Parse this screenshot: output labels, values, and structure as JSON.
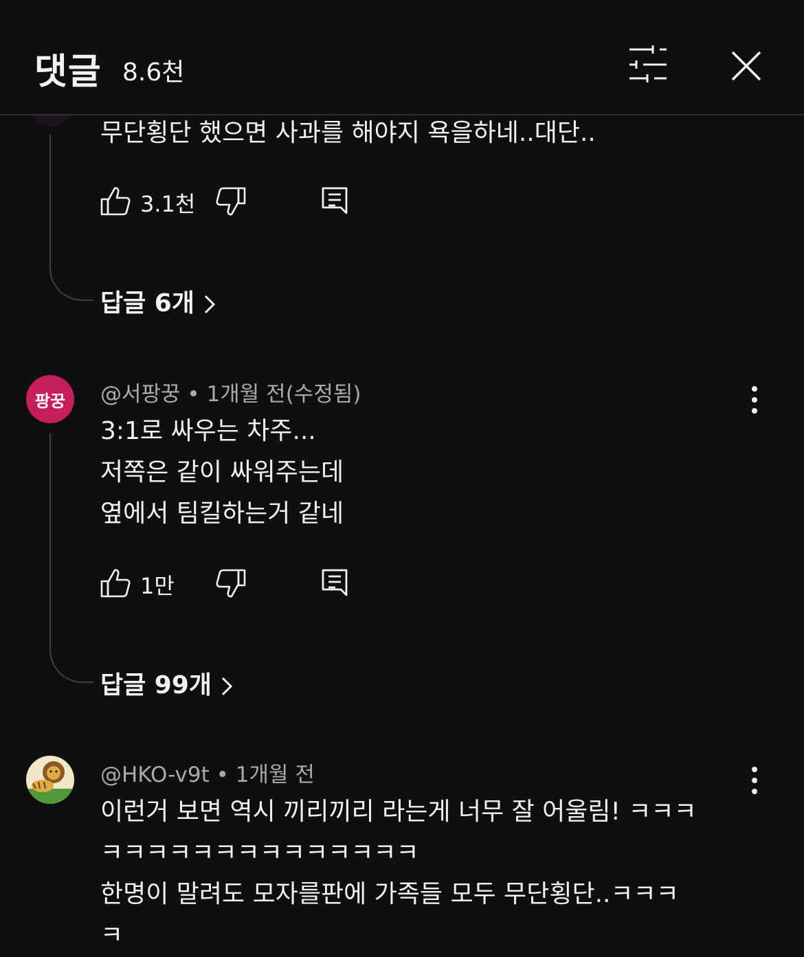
{
  "header": {
    "title": "댓글",
    "count": "8.6천"
  },
  "comments": [
    {
      "text_lines": [
        "무단횡단 했으면 사과를 해야지 욕을하네..대단.."
      ],
      "likes": "3.1천",
      "replies_label": "답글 6개"
    },
    {
      "avatar_text": "팡꿍",
      "avatar_color": "#c41e5c",
      "author": "@서팡꿍",
      "time": "1개월 전(수정됨)",
      "text_lines": [
        "3:1로 싸우는 차주...",
        "저쪽은 같이 싸워주는데",
        "옆에서 팀킬하는거 같네"
      ],
      "likes": "1만",
      "replies_label": "답글 99개"
    },
    {
      "avatar_icon": "lion-avatar",
      "author": "@HKO-v9t",
      "time": "1개월 전",
      "text_lines": [
        "이런거 보면 역시 끼리끼리 라는게 너무 잘 어울림! ㅋㅋㅋ",
        "ㅋㅋㅋㅋㅋㅋㅋㅋㅋㅋㅋㅋㅋㅋ",
        "한명이 말려도 모자를판에 가족들 모두 무단횡단..ㅋㅋㅋ",
        "ㅋ"
      ]
    }
  ],
  "icons": {
    "filter": "tune-icon",
    "close": "close-icon",
    "like": "thumb-up-icon",
    "dislike": "thumb-down-icon",
    "reply": "comment-icon",
    "more": "more-vert-icon",
    "chevron": "chevron-right-icon"
  },
  "colors": {
    "background": "#0f0f0f",
    "text": "#f1f1f1",
    "meta": "#aaaaaa"
  }
}
